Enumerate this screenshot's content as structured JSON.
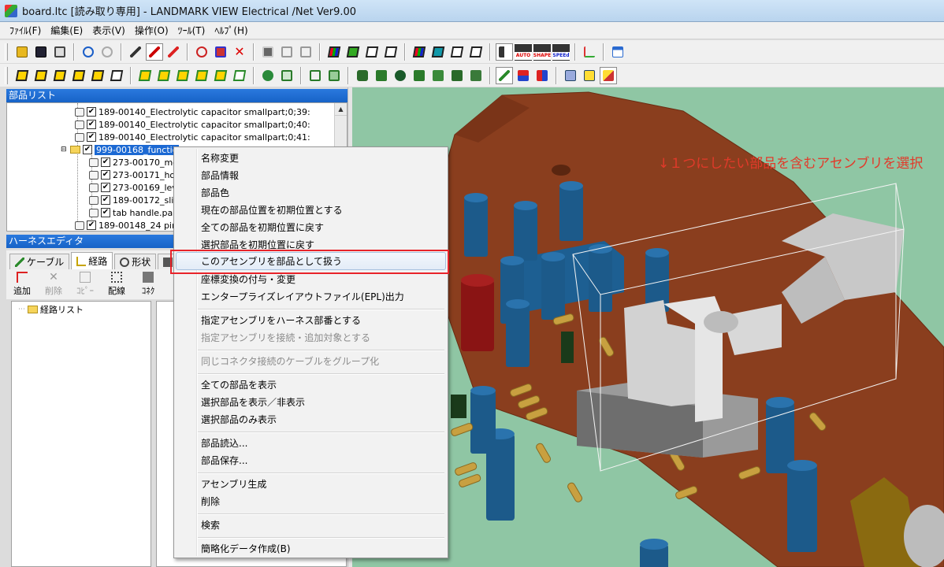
{
  "window": {
    "title": "board.ltc [読み取り専用] - LANDMARK VIEW Electrical /Net Ver9.00"
  },
  "menu": [
    "ﾌｧｲﾙ(F)",
    "編集(E)",
    "表示(V)",
    "操作(O)",
    "ﾂｰﾙ(T)",
    "ﾍﾙﾌﾟ(H)"
  ],
  "toolbar_badges": {
    "auto": "AUTO",
    "shape": "SHAPE",
    "speed": "SPEEd"
  },
  "parts_panel": {
    "title": "部品リスト",
    "rows": [
      "189-00140_Electrolytic capacitor smallpart;0;39:",
      "189-00140_Electrolytic capacitor smallpart;0;40:",
      "189-00140_Electrolytic capacitor smallpart;0;41:",
      "999-00168_functio",
      "273-00170_mo",
      "273-00171_ho",
      "273-00169_lev",
      "189-00172_sli",
      "tab handle.par",
      "189-00148_24 pin"
    ]
  },
  "harness_panel": {
    "title": "ハーネスエディタ",
    "tabs": [
      "ケーブル",
      "経路",
      "形状",
      ""
    ],
    "buttons": [
      {
        "label": "追加",
        "enabled": true
      },
      {
        "label": "削除",
        "enabled": false
      },
      {
        "label": "ｺﾋﾟｰ",
        "enabled": false
      },
      {
        "label": "配線",
        "enabled": true
      },
      {
        "label": "ｺﾈｸ",
        "enabled": true
      }
    ],
    "route_list_label": "経路リスト"
  },
  "viewport": {
    "annotation": "↓１つにしたい部品を含むアセンブリを選択"
  },
  "context_menu": {
    "items": [
      {
        "label": "名称変更",
        "enabled": true
      },
      {
        "label": "部品情報",
        "enabled": true
      },
      {
        "label": "部品色",
        "enabled": true
      },
      {
        "label": "現在の部品位置を初期位置とする",
        "enabled": true
      },
      {
        "label": "全ての部品を初期位置に戻す",
        "enabled": true
      },
      {
        "label": "選択部品を初期位置に戻す",
        "enabled": true
      },
      {
        "label": "このアセンブリを部品として扱う",
        "enabled": true,
        "highlighted": true
      },
      {
        "label": "座標変換の付与・変更",
        "enabled": true
      },
      {
        "label": "エンタープライズレイアウトファイル(EPL)出力",
        "enabled": true
      },
      {
        "label": "指定アセンブリをハーネス部番とする",
        "enabled": true
      },
      {
        "label": "指定アセンブリを接続・追加対象とする",
        "enabled": false
      },
      {
        "label": "同じコネクタ接続のケーブルをグループ化",
        "enabled": false
      },
      {
        "label": "全ての部品を表示",
        "enabled": true
      },
      {
        "label": "選択部品を表示／非表示",
        "enabled": true
      },
      {
        "label": "選択部品のみ表示",
        "enabled": true
      },
      {
        "label": "部品読込...",
        "enabled": true
      },
      {
        "label": "部品保存...",
        "enabled": true
      },
      {
        "label": "アセンブリ生成",
        "enabled": true
      },
      {
        "label": "削除",
        "enabled": true
      },
      {
        "label": "検索",
        "enabled": true
      },
      {
        "label": "簡略化データ作成(B)",
        "enabled": true
      }
    ]
  },
  "colors": {
    "highlight_border": "#e8232a",
    "selection": "#1c69d3",
    "annotation": "#e23a2a"
  }
}
